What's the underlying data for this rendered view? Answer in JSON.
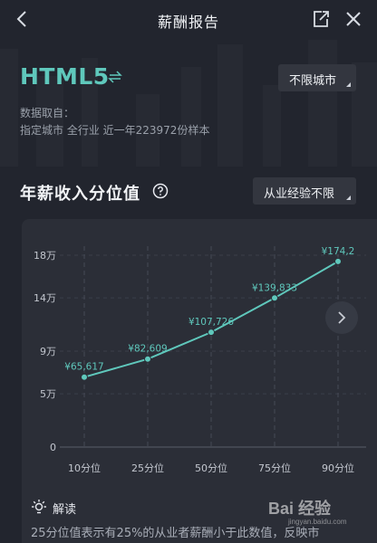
{
  "header": {
    "title": "薪酬报告"
  },
  "job": {
    "title": "HTML5"
  },
  "filters": {
    "city": "不限城市",
    "experience": "从业经验不限"
  },
  "source": {
    "label": "数据取自：",
    "detail": "指定城市  全行业  近一年223972份样本"
  },
  "section": {
    "title": "年薪收入分位值"
  },
  "chart_data": {
    "type": "line",
    "title": "",
    "categories": [
      "10分位",
      "25分位",
      "50分位",
      "75分位",
      "90分位"
    ],
    "values": [
      65617,
      82609,
      107726,
      139833,
      174200
    ],
    "data_labels": [
      "¥65,617",
      "¥82,609",
      "¥107,726",
      "¥139,833",
      "¥174,2"
    ],
    "y_ticks": [
      0,
      50000,
      90000,
      140000,
      180000
    ],
    "y_tick_labels": [
      "0",
      "5万",
      "9万",
      "14万",
      "18万"
    ],
    "ylim": [
      0,
      180000
    ],
    "grid": true,
    "line_color": "#5fc8bc"
  },
  "interpretation": {
    "title": "解读",
    "text": "25分位值表示有25%的从业者薪酬小于此数值，反映市"
  },
  "watermark": {
    "brand": "Bai 经验",
    "url": "jingyan.baidu.com"
  }
}
